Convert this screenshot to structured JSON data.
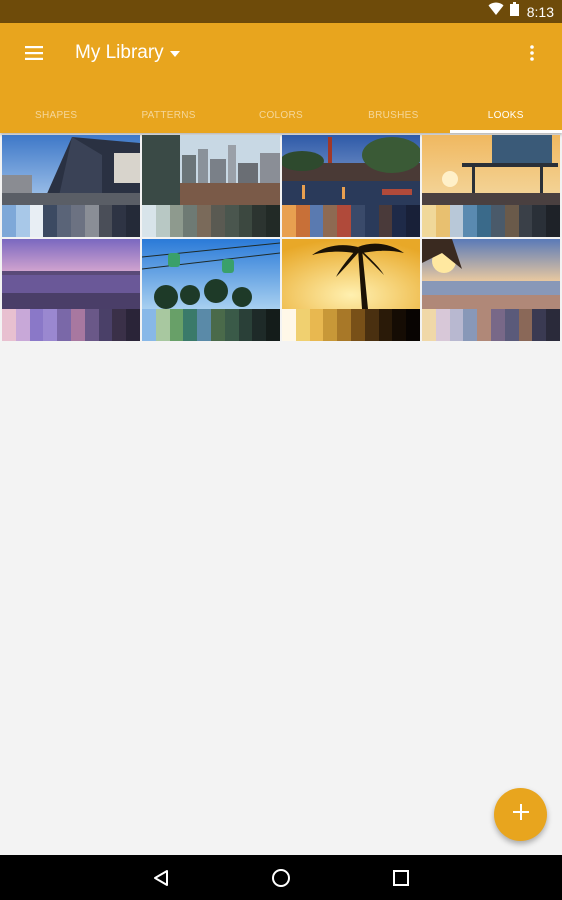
{
  "status_bar": {
    "time": "8:13",
    "icons": [
      "wifi-icon",
      "battery-icon"
    ]
  },
  "app_bar": {
    "title": "My Library",
    "icons": {
      "menu": "hamburger-menu-icon",
      "dropdown": "caret-down-icon",
      "more": "more-vert-icon"
    },
    "accent_color": "#e8a51e"
  },
  "tabs": [
    {
      "label": "SHAPES",
      "active": false
    },
    {
      "label": "PATTERNS",
      "active": false
    },
    {
      "label": "COLORS",
      "active": false
    },
    {
      "label": "BRUSHES",
      "active": false
    },
    {
      "label": "LOOKS",
      "active": true
    }
  ],
  "looks": [
    {
      "subject": "city-square",
      "swatches": [
        "#7ea8d8",
        "#a8c8e8",
        "#e8eef4",
        "#3c4a62",
        "#5a6478",
        "#6c7282",
        "#8a8e96",
        "#4a4e58",
        "#2e3444",
        "#242a38"
      ]
    },
    {
      "subject": "city-skyline",
      "swatches": [
        "#d8e4ea",
        "#b8c8c4",
        "#8e9a8e",
        "#6e7a74",
        "#7a6a5a",
        "#5a5a52",
        "#4a564e",
        "#3c4840",
        "#2c3430",
        "#222a26"
      ]
    },
    {
      "subject": "canal-at-dusk",
      "swatches": [
        "#e8a050",
        "#c87038",
        "#5a7ab0",
        "#8e6a52",
        "#b04a3a",
        "#3a4a6a",
        "#2a3a5a",
        "#4a3a3a",
        "#1e2a48",
        "#182038"
      ]
    },
    {
      "subject": "lifeguard-tower-sunset",
      "swatches": [
        "#f0d89a",
        "#e8c070",
        "#b8c8d8",
        "#5a8ab0",
        "#3a6a8a",
        "#4a5a6a",
        "#6a5a4a",
        "#3a4048",
        "#2a3038",
        "#1e2228"
      ]
    },
    {
      "subject": "purple-beach",
      "swatches": [
        "#e8c0d0",
        "#c8a8d8",
        "#8a78c8",
        "#9a88d0",
        "#7a68a8",
        "#a878a0",
        "#6a5888",
        "#4a4068",
        "#3a3048",
        "#2a2438"
      ]
    },
    {
      "subject": "gondola-palms",
      "swatches": [
        "#88b8e8",
        "#a8c8a0",
        "#68a068",
        "#3a7a6a",
        "#5a8aa8",
        "#4a6a4a",
        "#3a5a48",
        "#2a4038",
        "#1e2a28",
        "#141c1a"
      ]
    },
    {
      "subject": "palm-silhouette",
      "swatches": [
        "#fff8e8",
        "#f0d070",
        "#e8b850",
        "#c89838",
        "#a87828",
        "#785018",
        "#4a3010",
        "#2a1a08",
        "#150c04",
        "#080402"
      ]
    },
    {
      "subject": "sunrise-beach",
      "swatches": [
        "#f0d8a8",
        "#d8c8d8",
        "#b8b8d0",
        "#8898b8",
        "#b08878",
        "#786888",
        "#5a5a7a",
        "#8a6858",
        "#3a3a52",
        "#2a2a3a"
      ]
    }
  ],
  "fab": {
    "icon": "plus-icon"
  },
  "nav_bar": {
    "icons": [
      "back-icon",
      "home-icon",
      "recents-icon"
    ]
  }
}
